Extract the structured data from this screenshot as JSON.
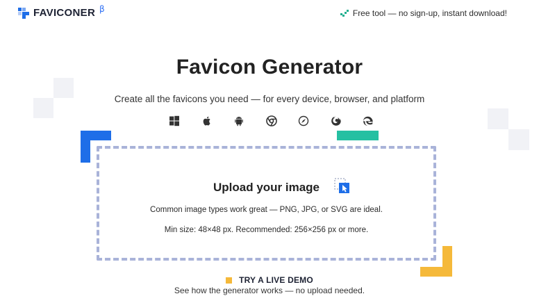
{
  "header": {
    "logo_text": "FAVICONER",
    "beta_mark": "β",
    "promo_text": "Free tool — no sign-up, instant download!"
  },
  "hero": {
    "title": "Favicon Generator",
    "subtitle": "Create all the favicons you need — for every device, browser, and platform"
  },
  "platforms": [
    {
      "icon": "windows-icon"
    },
    {
      "icon": "apple-icon"
    },
    {
      "icon": "android-icon"
    },
    {
      "icon": "chrome-icon"
    },
    {
      "icon": "safari-icon"
    },
    {
      "icon": "firefox-icon"
    },
    {
      "icon": "edge-icon"
    }
  ],
  "upload": {
    "title": "Upload your image",
    "formats_text": "Common image types work great — PNG, JPG, or SVG are ideal.",
    "size_text": "Min size: 48×48 px. Recommended: 256×256 px or more."
  },
  "demo": {
    "link_label": "TRY A LIVE DEMO",
    "description": "See how the generator works — no upload needed."
  },
  "colors": {
    "brand_blue": "#1e6ee8",
    "teal": "#25c0a2",
    "yellow": "#f5b93a",
    "dashed_border": "#a9b3d9",
    "check_green": "#1fae8e"
  }
}
